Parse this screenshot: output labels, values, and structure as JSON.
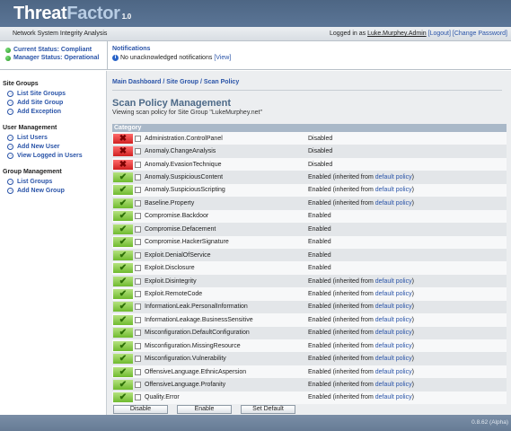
{
  "app": {
    "name_part1": "Threat",
    "name_part2": "Factor",
    "version_label": "1.0",
    "subtitle": "Network System Integrity Analysis"
  },
  "session": {
    "logged_in_prefix": "Logged in as",
    "username": "Luke.Murphey.Admin",
    "logout_label": "[Logout]",
    "change_password_label": "[Change Password]"
  },
  "status": {
    "current_status": "Current Status: Compliant",
    "manager_status": "Manager Status: Operational"
  },
  "notifications": {
    "title": "Notifications",
    "message": "No unacknowledged notifications",
    "view_label": "[View]"
  },
  "sidebar": {
    "groups": [
      {
        "title": "Site Groups",
        "items": [
          "List Site Groups",
          "Add Site Group",
          "Add Exception"
        ]
      },
      {
        "title": "User Management",
        "items": [
          "List Users",
          "Add New User",
          "View Logged in Users"
        ]
      },
      {
        "title": "Group Management",
        "items": [
          "List Groups",
          "Add New Group"
        ]
      }
    ]
  },
  "breadcrumb": [
    "Main Dashboard",
    "Site Group",
    "Scan Policy"
  ],
  "page": {
    "title": "Scan Policy Management",
    "subtitle": "Viewing scan policy for Site Group \"LukeMurphey.net\""
  },
  "table": {
    "header": "Category",
    "inherited_prefix": "(inherited from",
    "inherited_link": "default policy",
    "inherited_suffix": ")",
    "rows": [
      {
        "name": "Administration.ControlPanel",
        "status": "Disabled",
        "inherited": false
      },
      {
        "name": "Anomaly.ChangeAnalysis",
        "status": "Disabled",
        "inherited": false
      },
      {
        "name": "Anomaly.EvasionTechnique",
        "status": "Disabled",
        "inherited": false
      },
      {
        "name": "Anomaly.SuspiciousContent",
        "status": "Enabled",
        "inherited": true
      },
      {
        "name": "Anomaly.SuspiciousScripting",
        "status": "Enabled",
        "inherited": true
      },
      {
        "name": "Baseline.Property",
        "status": "Enabled",
        "inherited": true
      },
      {
        "name": "Compromise.Backdoor",
        "status": "Enabled",
        "inherited": false
      },
      {
        "name": "Compromise.Defacement",
        "status": "Enabled",
        "inherited": false
      },
      {
        "name": "Compromise.HackerSignature",
        "status": "Enabled",
        "inherited": false
      },
      {
        "name": "Exploit.DenialOfService",
        "status": "Enabled",
        "inherited": false
      },
      {
        "name": "Exploit.Disclosure",
        "status": "Enabled",
        "inherited": false
      },
      {
        "name": "Exploit.Disintegrity",
        "status": "Enabled",
        "inherited": true
      },
      {
        "name": "Exploit.RemoteCode",
        "status": "Enabled",
        "inherited": true
      },
      {
        "name": "InformationLeak.PersonalInformation",
        "status": "Enabled",
        "inherited": true
      },
      {
        "name": "InformationLeakage.BusinessSensitive",
        "status": "Enabled",
        "inherited": true
      },
      {
        "name": "Misconfiguration.DefaultConfiguration",
        "status": "Enabled",
        "inherited": true
      },
      {
        "name": "Misconfiguration.MissingResource",
        "status": "Enabled",
        "inherited": true
      },
      {
        "name": "Misconfiguration.Vulnerability",
        "status": "Enabled",
        "inherited": true
      },
      {
        "name": "OffensiveLanguage.EthnicAspersion",
        "status": "Enabled",
        "inherited": true
      },
      {
        "name": "OffensiveLanguage.Profanity",
        "status": "Enabled",
        "inherited": true
      },
      {
        "name": "Quality.Error",
        "status": "Enabled",
        "inherited": true
      }
    ]
  },
  "buttons": {
    "disable": "Disable",
    "enable": "Enable",
    "set_default": "Set Default"
  },
  "footer": {
    "version": "0.8.62 (Alpha)"
  },
  "icons": {
    "enabled": "checkmark-icon",
    "disabled": "red-x-icon",
    "status_dot": "green-dot-icon",
    "info": "info-icon",
    "nav_arrow": "circle-arrow-icon"
  },
  "colors": {
    "header_bg": "#5b7596",
    "link": "#2a54a8",
    "enabled_green": "#6fba2e",
    "disabled_red": "#d02020",
    "table_header": "#a9b8c8"
  }
}
